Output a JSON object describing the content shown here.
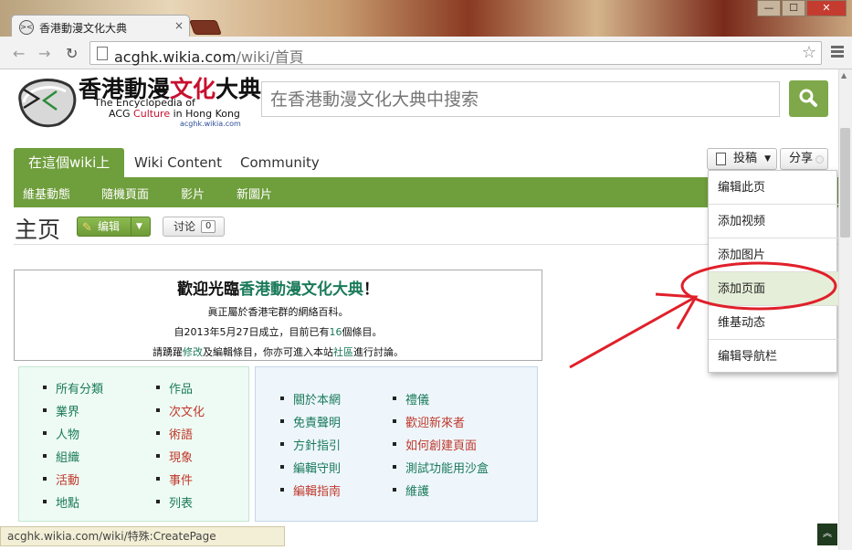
{
  "browser": {
    "tab_title": "香港動漫文化大典",
    "tab_close": "×",
    "url_host": "acghk.wikia.com",
    "url_path": "/wiki/首頁",
    "window_controls": [
      "—",
      "☐",
      "✕"
    ],
    "status_url": "acghk.wikia.com/wiki/特殊:CreatePage"
  },
  "logo": {
    "title_black": "香港動漫",
    "title_red": "文化",
    "title_black2": "大典",
    "sub1": "The Encyclopedia of",
    "sub2_a": "ACG ",
    "sub2_b": "Culture",
    "sub2_c": " in Hong Kong",
    "sub3": "acghk.wikia.com"
  },
  "search": {
    "placeholder": "在香港動漫文化大典中搜索"
  },
  "tabs": [
    {
      "label": "在這個wiki上"
    },
    {
      "label": "Wiki Content"
    },
    {
      "label": "Community"
    }
  ],
  "contribute": {
    "label": "投稿",
    "caret": "▼"
  },
  "share": {
    "label": "分享"
  },
  "subnav": [
    "維基動態",
    "隨機頁面",
    "影片",
    "新圖片"
  ],
  "page": {
    "title": "主页",
    "edit_label": "编辑",
    "talk_label": "讨论",
    "talk_count": "0"
  },
  "welcome": {
    "head_a": "歡迎光臨",
    "head_site": "香港動漫文化大典",
    "head_b": "！",
    "line1": "眞正屬於香港宅群的網絡百科。",
    "line2_a": "自2013年5月27日成立，目前已有",
    "line2_count": "16",
    "line2_b": "個條目。",
    "line3_a": "請踴躍",
    "line3_edit": "修改",
    "line3_b": "及編輯條目，你亦可進入本站",
    "line3_community": "社區",
    "line3_c": "進行討論。"
  },
  "left_list": {
    "col1": [
      "所有分類",
      "業界",
      "人物",
      "組織",
      "活動",
      "地點"
    ],
    "col2": [
      "作品",
      "次文化",
      "術語",
      "現象",
      "事件",
      "列表"
    ]
  },
  "right_list": {
    "col1": [
      "關於本網",
      "免責聲明",
      "方針指引",
      "編輯守則",
      "編輯指南"
    ],
    "col2": [
      "禮儀",
      "歡迎新來者",
      "如何創建頁面",
      "測試功能用沙盒",
      "維護"
    ]
  },
  "dropdown": [
    "编辑此页",
    "添加视频",
    "添加图片",
    "添加页面",
    "维基动态",
    "编辑导航栏"
  ],
  "colors": {
    "accent_green": "#6f9e3c",
    "annotation_red": "#e0202a",
    "link_green": "#1a7a5a",
    "link_red": "#c0392b"
  }
}
